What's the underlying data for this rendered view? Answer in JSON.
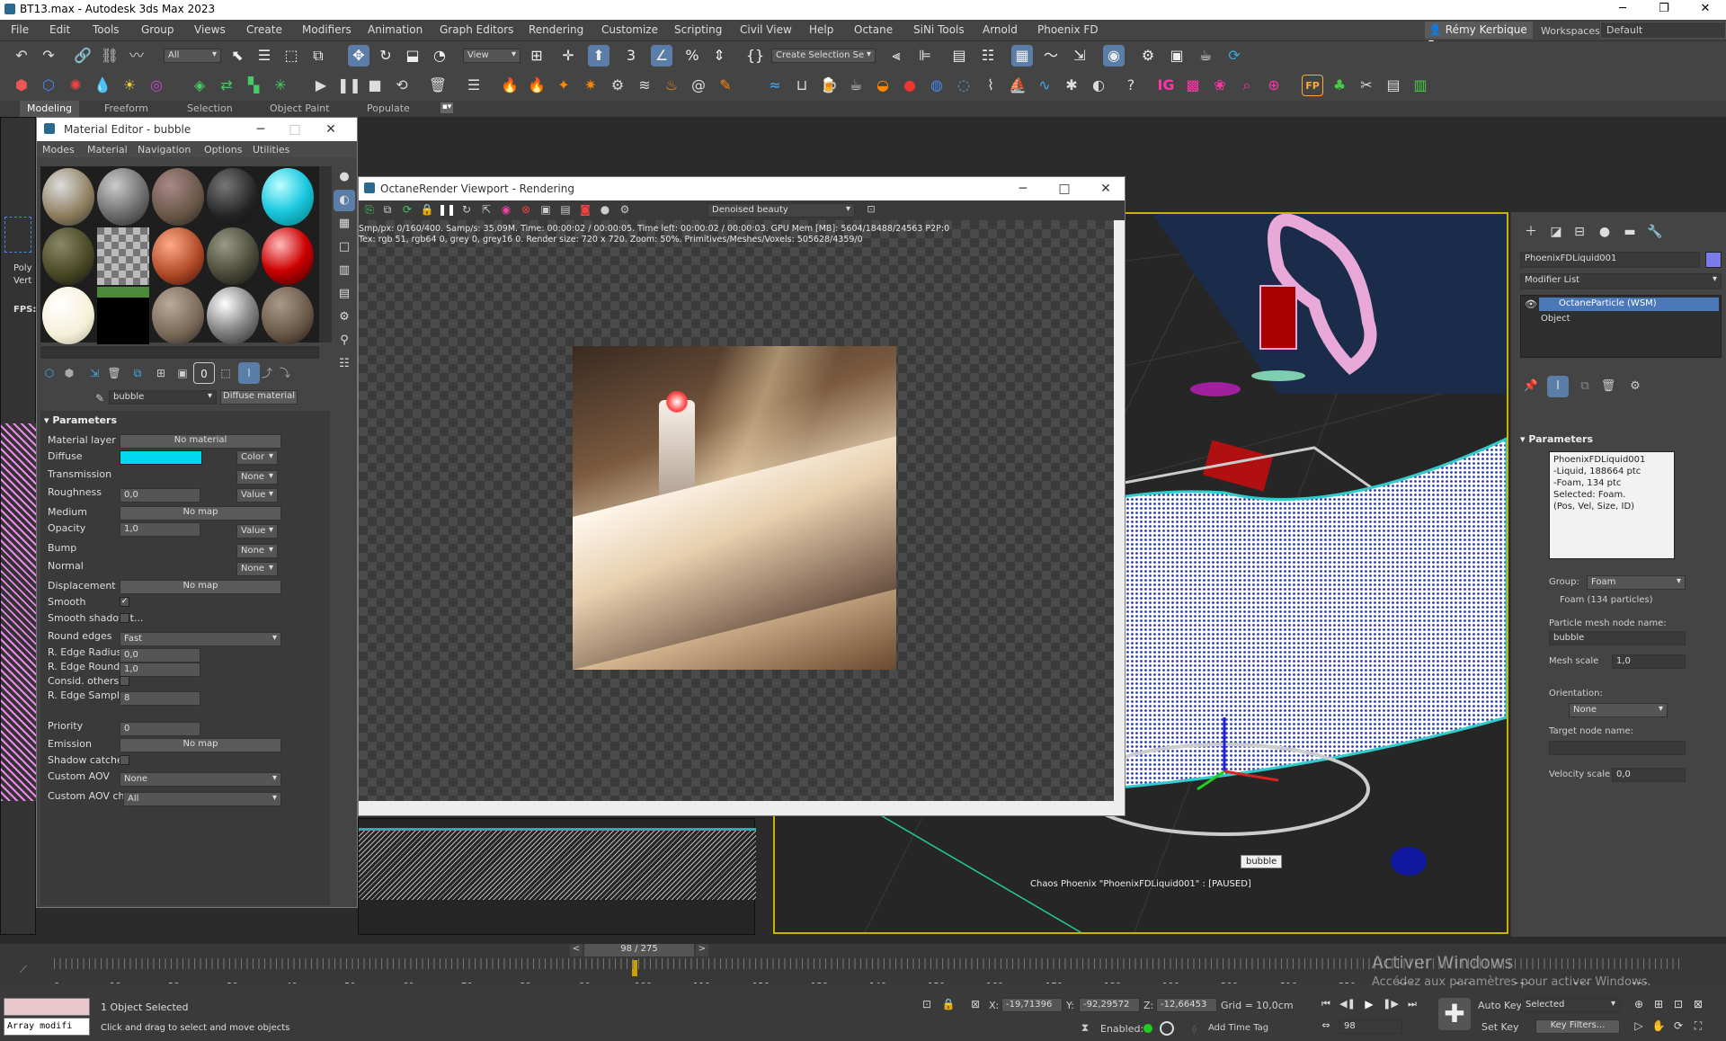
{
  "app": {
    "title": "BT13.max - Autodesk 3ds Max 2023"
  },
  "menus": [
    "File",
    "Edit",
    "Tools",
    "Group",
    "Views",
    "Create",
    "Modifiers",
    "Animation",
    "Graph Editors",
    "Rendering",
    "Customize",
    "Scripting",
    "Civil View",
    "Help",
    "Octane",
    "SiNi Tools",
    "Arnold",
    "Phoenix FD"
  ],
  "user": "Rémy Kerbique",
  "workspaces": {
    "label": "Workspaces:",
    "value": "Default"
  },
  "toolbar": {
    "filter": "All",
    "view": "View",
    "selection_set": "Create Selection Se"
  },
  "ribbon": {
    "tabs": [
      "Modeling",
      "Freeform",
      "Selection",
      "Object Paint",
      "Populate"
    ]
  },
  "left_viewport": {
    "label1": "Poly",
    "label2": "Vert",
    "fps": "FPS:"
  },
  "material_editor": {
    "title": "Material Editor - bubble",
    "menus": [
      "Modes",
      "Material",
      "Navigation",
      "Options",
      "Utilities"
    ],
    "material_name": "bubble",
    "material_type": "Diffuse material",
    "rollout": "Parameters",
    "rows": [
      {
        "label": "Material layer",
        "button": "No material"
      },
      {
        "label": "Diffuse",
        "select": "Color"
      },
      {
        "label": "Transmission",
        "select": "None"
      },
      {
        "label": "Roughness",
        "value": "0,0",
        "select": "Value"
      },
      {
        "label": "Medium",
        "button": "No map"
      },
      {
        "label": "Opacity",
        "value": "1,0",
        "select": "Value"
      },
      {
        "label": "Bump",
        "select": "None"
      },
      {
        "label": "Normal",
        "select": "None"
      },
      {
        "label": "Displacement",
        "button": "No map"
      },
      {
        "label": "Smooth",
        "check": "✓"
      },
      {
        "label": "Smooth shadow t..."
      },
      {
        "label": "Round edges",
        "dropdown": "Fast"
      },
      {
        "label": "R. Edge Radius",
        "value": "0,0"
      },
      {
        "label": "R. Edge Roundness",
        "value": "1,0"
      },
      {
        "label": "Consid. others"
      },
      {
        "label": "R. Edge Samples",
        "value": "8"
      },
      {
        "label": "Priority",
        "value": "0"
      },
      {
        "label": "Emission",
        "button": "No map"
      },
      {
        "label": "Shadow catcher"
      },
      {
        "label": "Custom AOV",
        "dropdown": "None"
      },
      {
        "label": "Custom AOV channel",
        "dropdown": "All"
      }
    ],
    "diffuse_color": "#00d8f0"
  },
  "octane": {
    "title": "OctaneRender Viewport - Rendering",
    "mode": "Denoised beauty",
    "stats1": "Smp/px: 0/160/400.   Samp/s: 35,09M.   Time: 00:00:02 / 00:00:05.   Time left: 00:00:02 / 00:00:03.   GPU Mem [MB]: 5604/18488/24563 P2P:0",
    "stats2": "Tex: rgb 51, rgb64 0, grey 0, grey16 0.   Render size: 720 x 720.   Zoom: 50%.   Primitives/Meshes/Voxels: 505628/4359/0"
  },
  "viewport": {
    "tooltip": "bubble",
    "phoenix_status": "Chaos Phoenix \"PhoenixFDLiquid001\" : [PAUSED]"
  },
  "command_panel": {
    "object_name": "PhoenixFDLiquid001",
    "modifier_list": "Modifier List",
    "stack": [
      "OctaneParticle (WSM)",
      "Object"
    ],
    "rollout": "Parameters",
    "info": [
      "PhoenixFDLiquid001",
      "-Liquid, 188664 ptc",
      "-Foam, 134 ptc",
      "Selected: Foam.",
      "(Pos, Vel, Size, ID)"
    ],
    "group_label": "Group:",
    "group_value": "Foam",
    "group_count": "Foam (134 particles)",
    "mesh_node_label": "Particle mesh node name:",
    "mesh_node_value": "bubble",
    "mesh_scale_label": "Mesh scale",
    "mesh_scale_value": "1,0",
    "orientation_label": "Orientation:",
    "orientation_value": "None",
    "target_label": "Target node name:",
    "velocity_label": "Velocity scale",
    "velocity_value": "0,0"
  },
  "timeline": {
    "frame": "98 / 275",
    "ticks": [
      "0",
      "10",
      "20",
      "30",
      "40",
      "50",
      "60",
      "70",
      "80",
      "90",
      "100",
      "110",
      "120",
      "130",
      "140",
      "150",
      "160",
      "170",
      "180",
      "190",
      "200",
      "210",
      "220",
      "230",
      "240",
      "250",
      "260",
      "270"
    ]
  },
  "status": {
    "maxscript": "Array modifi",
    "selected": "1 Object Selected",
    "hint": "Click and drag to select and move objects",
    "x_label": "X:",
    "x": "-19,71396",
    "y_label": "Y:",
    "y": "-92,29572",
    "z_label": "Z:",
    "z": "-12,66453",
    "grid": "Grid = 10,0cm",
    "enabled": "Enabled:",
    "add_time_tag": "Add Time Tag",
    "auto_key": "Auto Key",
    "set_key": "Set Key",
    "selected_dropdown": "Selected",
    "key_filters": "Key Filters...",
    "frame_field": "98"
  },
  "watermark": {
    "line1": "Activer Windows",
    "line2": "Accédez aux paramètres pour activer Windows."
  }
}
